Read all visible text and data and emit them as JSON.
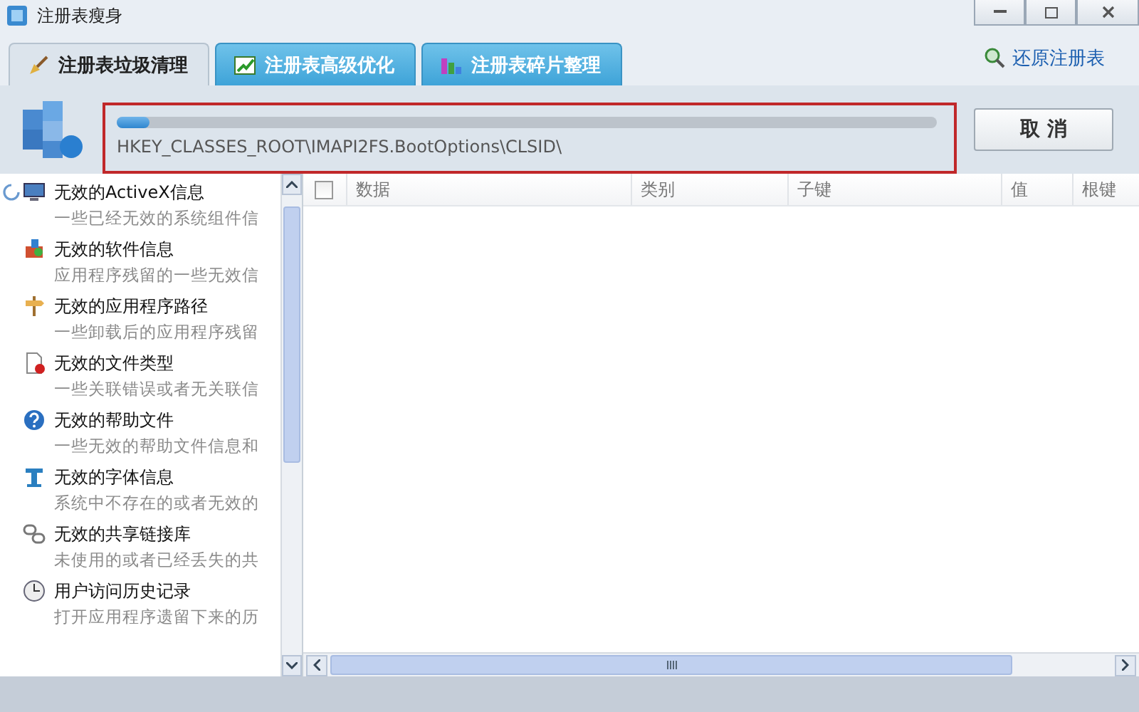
{
  "window": {
    "title": "注册表瘦身"
  },
  "tabs": [
    {
      "label": "注册表垃圾清理",
      "selected": true,
      "kind": "broom"
    },
    {
      "label": "注册表高级优化",
      "selected": false,
      "kind": "chart"
    },
    {
      "label": "注册表碎片整理",
      "selected": false,
      "kind": "blocks"
    }
  ],
  "restore_link": "还原注册表",
  "scan": {
    "level": 0.04,
    "path": "HKEY_CLASSES_ROOT\\IMAPI2FS.BootOptions\\CLSID\\",
    "cancel": "取 消"
  },
  "categories": [
    {
      "title": "无效的ActiveX信息",
      "desc": "一些已经无效的系统组件信",
      "kind": "monitor",
      "scanning": true
    },
    {
      "title": "无效的软件信息",
      "desc": "应用程序残留的一些无效信",
      "kind": "software",
      "scanning": false
    },
    {
      "title": "无效的应用程序路径",
      "desc": "一些卸载后的应用程序残留",
      "kind": "signpost",
      "scanning": false
    },
    {
      "title": "无效的文件类型",
      "desc": "一些关联错误或者无关联信",
      "kind": "file",
      "scanning": false
    },
    {
      "title": "无效的帮助文件",
      "desc": "一些无效的帮助文件信息和",
      "kind": "help",
      "scanning": false
    },
    {
      "title": "无效的字体信息",
      "desc": "系统中不存在的或者无效的",
      "kind": "font",
      "scanning": false
    },
    {
      "title": "无效的共享链接库",
      "desc": "未使用的或者已经丢失的共",
      "kind": "link",
      "scanning": false
    },
    {
      "title": "用户访问历史记录",
      "desc": "打开应用程序遗留下来的历",
      "kind": "clock",
      "scanning": false
    }
  ],
  "table": {
    "select_all": {
      "checked": false
    },
    "columns": [
      "数据",
      "类别",
      "子键",
      "值",
      "根键"
    ]
  }
}
